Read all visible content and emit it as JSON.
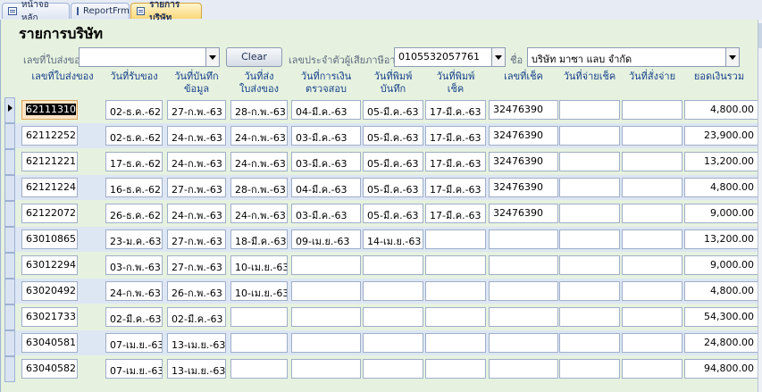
{
  "tabs": [
    {
      "label": "หน้าจอหลัก"
    },
    {
      "label": "ReportFrm"
    },
    {
      "label": "รายการบริษัท"
    }
  ],
  "form": {
    "title": "รายการบริษัท",
    "delivery_no_label": "เลขที่ใบส่งของ",
    "delivery_no_value": "",
    "clear_label": "Clear",
    "taxid_label": "เลขประจำตัวผู้เสียภาษีอากร",
    "taxid_value": "0105532057761",
    "name_label": "ชื่อ",
    "name_value": "บริษัท มาซา แลบ จำกัด"
  },
  "columns": [
    "เลขที่ใบส่งของ",
    "วันที่รับของ",
    "วันที่บันทึก ข้อมูล",
    "วันที่ส่ง ใบส่งของ",
    "วันที่การเงิน ตรวจสอบ",
    "วันที่พิมพ์ บันทึก",
    "วันที่พิมพ์ เช็ค",
    "เลขที่เช็ค",
    "วันที่จ่ายเช็ค",
    "วันที่สั่งจ่าย",
    "ยอดเงินรวม"
  ],
  "rows": [
    [
      "62111310",
      "02-ธ.ค.-62",
      "27-ก.พ.-63",
      "28-ก.พ.-63",
      "04-มี.ค.-63",
      "05-มี.ค.-63",
      "17-มี.ค.-63",
      "32476390",
      "",
      "",
      "4,800.00"
    ],
    [
      "62112252",
      "02-ธ.ค.-62",
      "24-ก.พ.-63",
      "24-ก.พ.-63",
      "03-มี.ค.-63",
      "05-มี.ค.-63",
      "17-มี.ค.-63",
      "32476390",
      "",
      "",
      "23,900.00"
    ],
    [
      "62121221",
      "17-ธ.ค.-62",
      "24-ก.พ.-63",
      "24-ก.พ.-63",
      "03-มี.ค.-63",
      "05-มี.ค.-63",
      "17-มี.ค.-63",
      "32476390",
      "",
      "",
      "13,200.00"
    ],
    [
      "62121224",
      "16-ธ.ค.-62",
      "27-ก.พ.-63",
      "28-ก.พ.-63",
      "04-มี.ค.-63",
      "05-มี.ค.-63",
      "17-มี.ค.-63",
      "32476390",
      "",
      "",
      "4,800.00"
    ],
    [
      "62122072",
      "26-ธ.ค.-62",
      "24-ก.พ.-63",
      "24-ก.พ.-63",
      "03-มี.ค.-63",
      "05-มี.ค.-63",
      "17-มี.ค.-63",
      "32476390",
      "",
      "",
      "9,000.00"
    ],
    [
      "63010865",
      "23-ม.ค.-63",
      "27-ก.พ.-63",
      "18-มี.ค.-63",
      "09-เม.ย.-63",
      "14-เม.ย.-63",
      "",
      "",
      "",
      "",
      "13,200.00"
    ],
    [
      "63012294",
      "03-ก.พ.-63",
      "27-ก.พ.-63",
      "10-เม.ย.-63",
      "",
      "",
      "",
      "",
      "",
      "",
      "9,000.00"
    ],
    [
      "63020492",
      "24-ก.พ.-63",
      "26-ก.พ.-63",
      "10-เม.ย.-63",
      "",
      "",
      "",
      "",
      "",
      "",
      "4,800.00"
    ],
    [
      "63021733",
      "02-มี.ค.-63",
      "02-มี.ค.-63",
      "",
      "",
      "",
      "",
      "",
      "",
      "",
      "54,300.00"
    ],
    [
      "63040581",
      "07-เม.ย.-63",
      "13-เม.ย.-63",
      "",
      "",
      "",
      "",
      "",
      "",
      "",
      "24,800.00"
    ],
    [
      "63040582",
      "07-เม.ย.-63",
      "13-เม.ย.-63",
      "",
      "",
      "",
      "",
      "",
      "",
      "",
      "94,800.00"
    ]
  ]
}
